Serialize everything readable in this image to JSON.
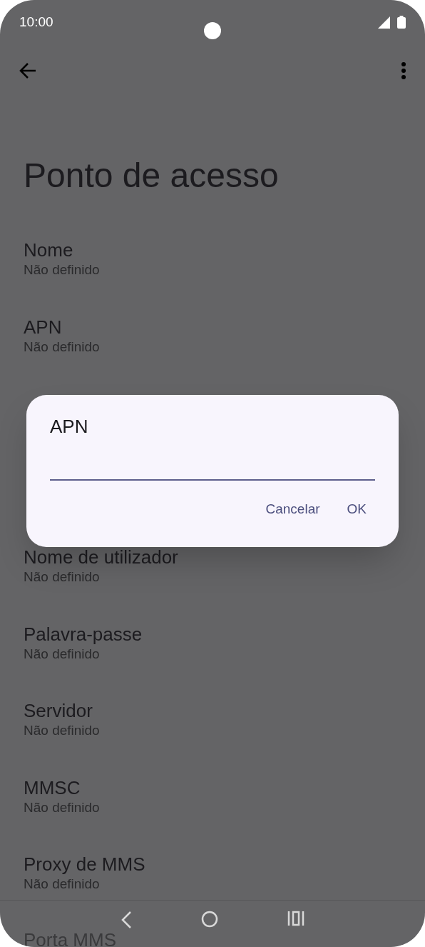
{
  "status_bar": {
    "time": "10:00"
  },
  "app_bar": {
    "title": "Ponto de acesso"
  },
  "settings": [
    {
      "title": "Nome",
      "value": "Não definido"
    },
    {
      "title": "APN",
      "value": "Não definido"
    },
    {
      "kind": "covered"
    },
    {
      "title": "Nome de utilizador",
      "value": "Não definido"
    },
    {
      "title": "Palavra-passe",
      "value": "Não definido"
    },
    {
      "title": "Servidor",
      "value": "Não definido"
    },
    {
      "title": "MMSC",
      "value": "Não definido"
    },
    {
      "title": "Proxy de MMS",
      "value": "Não definido"
    },
    {
      "title": "Porta MMS",
      "kind": "faded"
    }
  ],
  "dialog": {
    "title": "APN",
    "buttons": [
      "Cancelar",
      "OK"
    ]
  }
}
